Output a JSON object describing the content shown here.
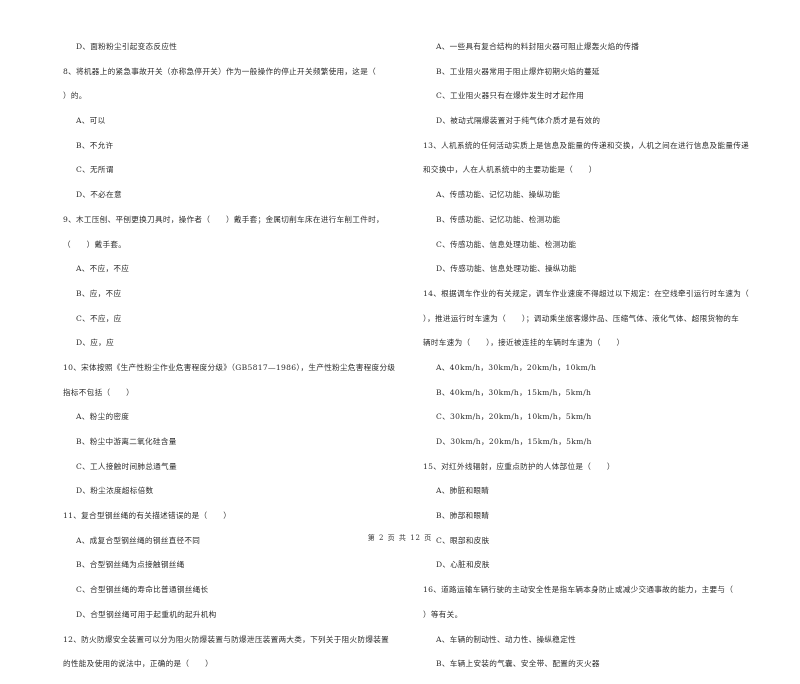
{
  "document": {
    "left_column": [
      {
        "type": "option",
        "text": "D、面粉粉尘引起变态反应性"
      },
      {
        "type": "question",
        "text": "8、将机器上的紧急事故开关（亦称急停开关）作为一般操作的停止开关频繁使用，这是（"
      },
      {
        "type": "continuation",
        "text": "）的。"
      },
      {
        "type": "option",
        "text": "A、可以"
      },
      {
        "type": "option",
        "text": "B、不允许"
      },
      {
        "type": "option",
        "text": "C、无所谓"
      },
      {
        "type": "option",
        "text": "D、不必在意"
      },
      {
        "type": "question",
        "text": "9、木工压刨、平刨更换刀具时，操作者（　　）戴手套；金属切削车床在进行车削工件时，"
      },
      {
        "type": "continuation",
        "text": "（　　）戴手套。"
      },
      {
        "type": "option",
        "text": "A、不应，不应"
      },
      {
        "type": "option",
        "text": "B、应，不应"
      },
      {
        "type": "option",
        "text": "C、不应，应"
      },
      {
        "type": "option",
        "text": "D、应，应"
      },
      {
        "type": "question",
        "text": "10、宋体按照《生产性粉尘作业危害程度分级》（GB5817—1986），生产性粉尘危害程度分级"
      },
      {
        "type": "continuation",
        "text": "指标不包括（　　）"
      },
      {
        "type": "option",
        "text": "A、粉尘的密度"
      },
      {
        "type": "option",
        "text": "B、粉尘中游离二氧化硅含量"
      },
      {
        "type": "option",
        "text": "C、工人接触时间肺总通气量"
      },
      {
        "type": "option",
        "text": "D、粉尘浓度超标倍数"
      },
      {
        "type": "question",
        "text": "11、复合型钢丝绳的有关描述错误的是（　　）"
      },
      {
        "type": "option",
        "text": "A、成复合型钢丝绳的钢丝直径不同"
      },
      {
        "type": "option",
        "text": "B、合型钢丝绳为点接触钢丝绳"
      },
      {
        "type": "option",
        "text": "C、合型钢丝绳的寿命比普通钢丝绳长"
      },
      {
        "type": "option",
        "text": "D、合型钢丝绳可用于起重机的起升机构"
      },
      {
        "type": "question",
        "text": "12、防火防爆安全装置可以分为阻火防爆装置与防爆泄压装置两大类，下列关于阻火防爆装置"
      },
      {
        "type": "continuation",
        "text": "的性能及使用的说法中，正确的是（　　）"
      }
    ],
    "right_column": [
      {
        "type": "option",
        "text": "A、一些具有复合结构的料封阻火器可阻止爆轰火焰的传播"
      },
      {
        "type": "option",
        "text": "B、工业阻火器常用于阻止爆炸初期火焰的蔓延"
      },
      {
        "type": "option",
        "text": "C、工业阻火器只有在爆炸发生时才起作用"
      },
      {
        "type": "option",
        "text": "D、被动式隔爆装置对于纯气体介质才是有效的"
      },
      {
        "type": "question",
        "text": "13、人机系统的任何活动实质上是信息及能量的传递和交换，人机之间在进行信息及能量传递"
      },
      {
        "type": "continuation",
        "text": "和交换中，人在人机系统中的主要功能是（　　）"
      },
      {
        "type": "option",
        "text": "A、传感功能、记忆功能、操纵功能"
      },
      {
        "type": "option",
        "text": "B、传感功能、记忆功能、检测功能"
      },
      {
        "type": "option",
        "text": "C、传感功能、信息处理功能、检测功能"
      },
      {
        "type": "option",
        "text": "D、传感功能、信息处理功能、操纵功能"
      },
      {
        "type": "question",
        "text": "14、根据调车作业的有关规定，调车作业速度不得超过以下规定：在空线牵引运行时车速为（"
      },
      {
        "type": "continuation",
        "text": "），推进运行时车速为（　　）；调动乘坐旅客爆炸品、压缩气体、液化气体、超限货物的车"
      },
      {
        "type": "continuation",
        "text": "辆时车速为（　　），接近被连挂的车辆时车速为（　　）"
      },
      {
        "type": "option",
        "text": "A、40km/h，30km/h，20km/h，10km/h"
      },
      {
        "type": "option",
        "text": "B、40km/h，30km/h，15km/h，5km/h"
      },
      {
        "type": "option",
        "text": "C、30km/h，20km/h，10km/h，5km/h"
      },
      {
        "type": "option",
        "text": "D、30km/h，20km/h，15km/h，5km/h"
      },
      {
        "type": "question",
        "text": "15、对红外线辐射，应重点防护的人体部位是（　　）"
      },
      {
        "type": "option",
        "text": "A、肺脏和眼睛"
      },
      {
        "type": "option",
        "text": "B、肺部和眼睛"
      },
      {
        "type": "option",
        "text": "C、眼部和皮肤"
      },
      {
        "type": "option",
        "text": "D、心脏和皮肤"
      },
      {
        "type": "question",
        "text": "16、道路运输车辆行驶的主动安全性是指车辆本身防止或减少交通事故的能力，主要与（"
      },
      {
        "type": "continuation",
        "text": "）等有关。"
      },
      {
        "type": "option",
        "text": "A、车辆的制动性、动力性、操纵稳定性"
      },
      {
        "type": "option",
        "text": "B、车辆上安装的气囊、安全带、配置的灭火器"
      }
    ],
    "footer": "第 2 页 共 12 页"
  }
}
